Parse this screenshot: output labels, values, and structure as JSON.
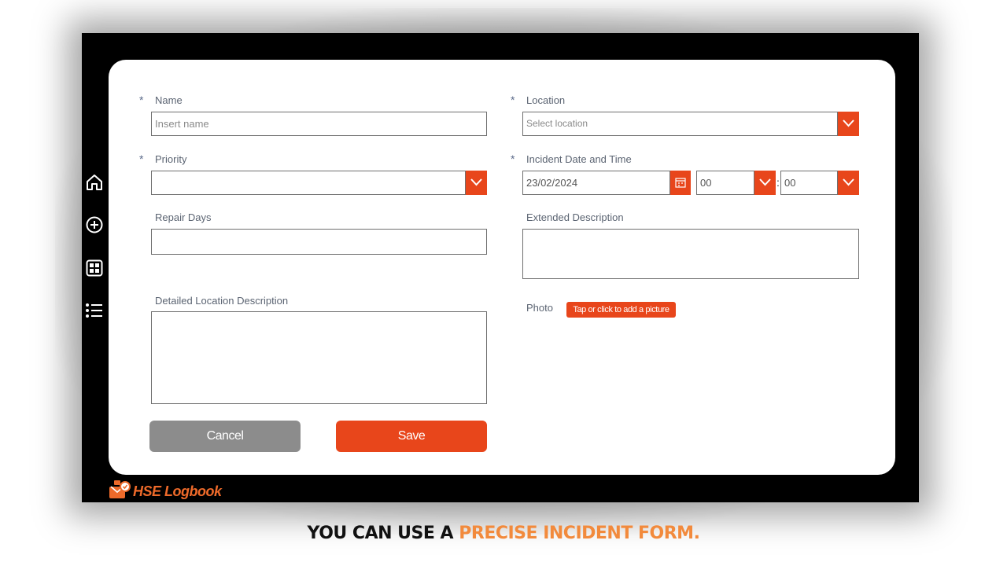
{
  "app": {
    "brand": "HSE Logbook",
    "accent": "#e8461b"
  },
  "nav": {
    "items": [
      {
        "icon": "home-icon"
      },
      {
        "icon": "plus-circle-icon"
      },
      {
        "icon": "grid-icon"
      },
      {
        "icon": "list-icon"
      }
    ]
  },
  "form": {
    "required_mark": "*",
    "name": {
      "label": "Name",
      "placeholder": "Insert name",
      "value": ""
    },
    "priority": {
      "label": "Priority",
      "value": ""
    },
    "repair_days": {
      "label": "Repair Days",
      "value": ""
    },
    "detailed_location": {
      "label": "Detailed Location Description",
      "value": ""
    },
    "location": {
      "label": "Location",
      "placeholder": "Select location",
      "value": ""
    },
    "incident_datetime": {
      "label": "Incident Date and Time",
      "date": "23/02/2024",
      "hour": "00",
      "minute": "00",
      "separator": ":"
    },
    "extended_description": {
      "label": "Extended Description",
      "value": ""
    },
    "photo": {
      "label": "Photo",
      "button": "Tap or click to add a picture"
    },
    "cancel": "Cancel",
    "save": "Save"
  },
  "caption": {
    "part1": "YOU CAN USE A ",
    "part2": "PRECISE INCIDENT FORM."
  }
}
